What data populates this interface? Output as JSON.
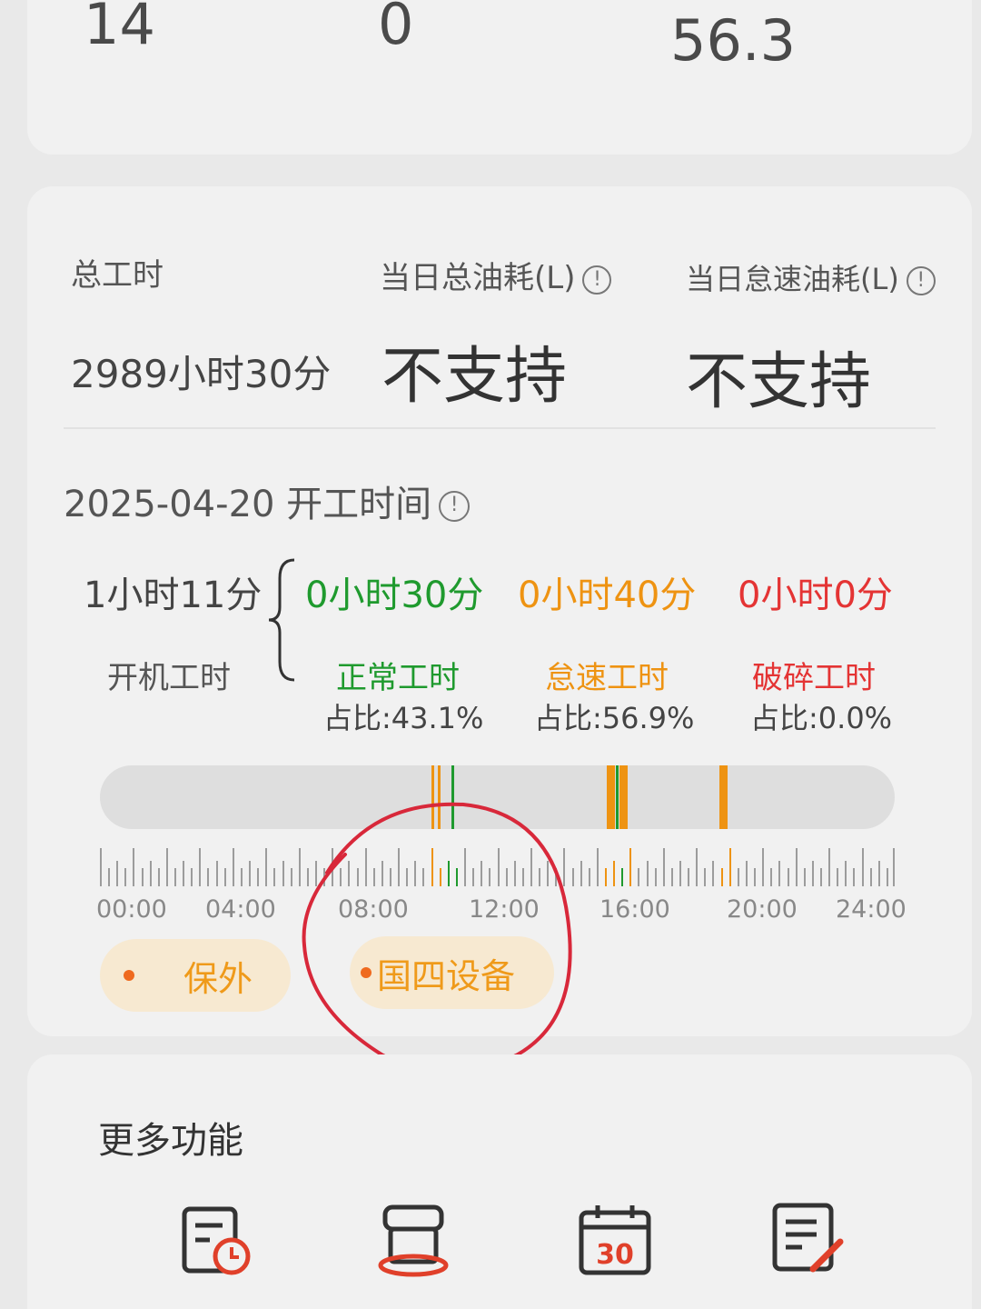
{
  "stats_top": {
    "v1": "14",
    "v2": "0",
    "v3": "56.3"
  },
  "summary": {
    "total_hours_label": "总工时",
    "total_hours_value": "2989小时30分",
    "daily_fuel_label": "当日总油耗(L)",
    "daily_fuel_value": "不支持",
    "idle_fuel_label": "当日怠速油耗(L)",
    "idle_fuel_value": "不支持"
  },
  "work_section": {
    "title": "2025-04-20 开工时间",
    "total_value": "1小时11分",
    "total_label": "开机工时",
    "normal": {
      "value": "0小时30分",
      "label": "正常工时",
      "ratio": "占比:43.1%"
    },
    "idle": {
      "value": "0小时40分",
      "label": "怠速工时",
      "ratio": "占比:56.9%"
    },
    "break": {
      "value": "0小时0分",
      "label": "破碎工时",
      "ratio": "占比:0.0%"
    }
  },
  "timeline": {
    "labels": [
      "00:00",
      "04:00",
      "08:00",
      "12:00",
      "16:00",
      "20:00",
      "24:00"
    ],
    "segments": [
      {
        "start_hour": 10.0,
        "end_hour": 10.1,
        "status": "idle"
      },
      {
        "start_hour": 10.2,
        "end_hour": 10.27,
        "status": "idle"
      },
      {
        "start_hour": 10.62,
        "end_hour": 10.7,
        "status": "normal"
      },
      {
        "start_hour": 15.3,
        "end_hour": 15.55,
        "status": "idle"
      },
      {
        "start_hour": 15.57,
        "end_hour": 15.65,
        "status": "normal"
      },
      {
        "start_hour": 15.68,
        "end_hour": 15.93,
        "status": "idle"
      },
      {
        "start_hour": 18.7,
        "end_hour": 18.95,
        "status": "idle"
      }
    ],
    "colors": {
      "normal": "#1f9a2e",
      "idle": "#ee9312",
      "break": "#e43434"
    }
  },
  "tags": [
    {
      "label": "保外"
    },
    {
      "label": "国四设备"
    }
  ],
  "more_functions": {
    "title": "更多功能",
    "items": [
      {
        "icon": "work-record-icon"
      },
      {
        "icon": "machine-icon"
      },
      {
        "icon": "calendar-icon",
        "number": "30"
      },
      {
        "icon": "feedback-icon"
      }
    ]
  }
}
